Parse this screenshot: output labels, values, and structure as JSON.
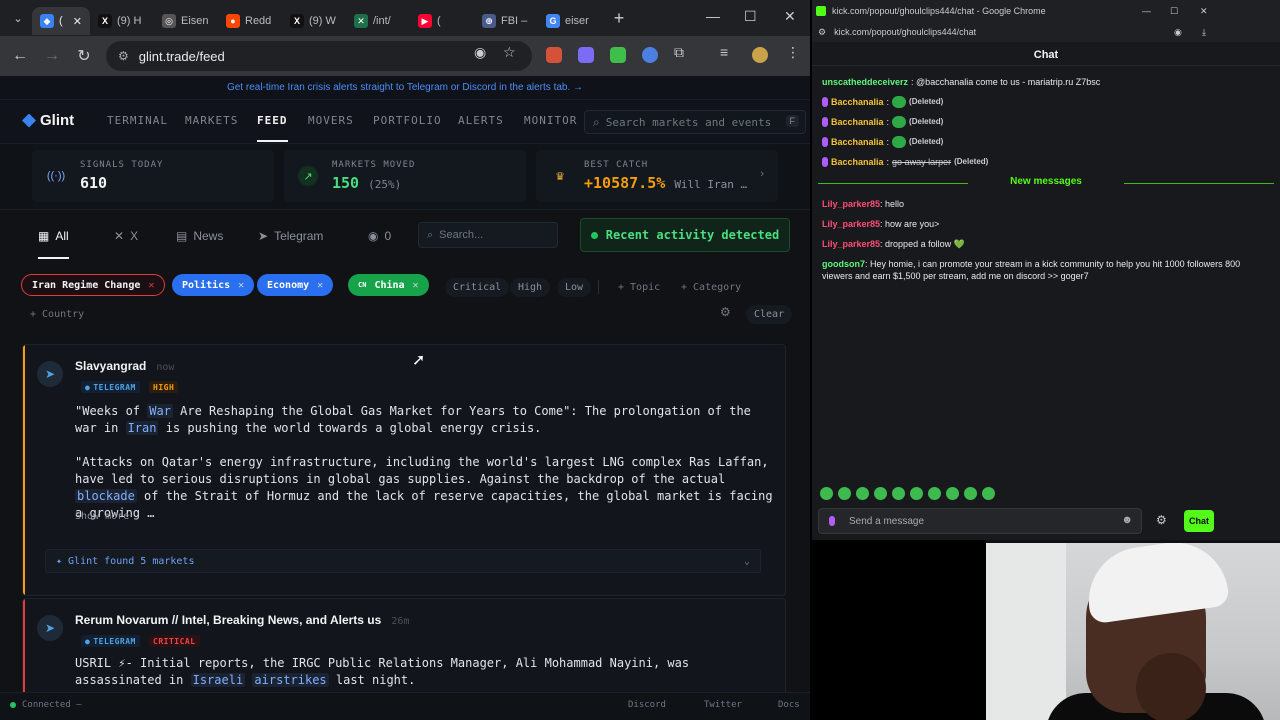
{
  "browser": {
    "tabs": [
      {
        "label": "(",
        "icon": "glint-icon",
        "color": "#3b82f6",
        "glyph": "◆",
        "active": true
      },
      {
        "label": "(9) H",
        "icon": "x-icon",
        "color": "#111111",
        "glyph": "X"
      },
      {
        "label": "Eisen",
        "icon": "web-icon",
        "color": "#555555",
        "glyph": "◎"
      },
      {
        "label": "Redd",
        "icon": "reddit-icon",
        "color": "#ff4500",
        "glyph": "●"
      },
      {
        "label": "(9) W",
        "icon": "x-icon",
        "color": "#111111",
        "glyph": "X"
      },
      {
        "label": "/int/",
        "icon": "board-icon",
        "color": "#1f6f4a",
        "glyph": "✕"
      },
      {
        "label": "(",
        "icon": "youtube-icon",
        "color": "#ff0033",
        "glyph": "▶"
      },
      {
        "label": "FBI –",
        "icon": "fbi-icon",
        "color": "#4a5a8a",
        "glyph": "⊕"
      },
      {
        "label": "eiser",
        "icon": "google-icon",
        "color": "#4285f4",
        "glyph": "G"
      }
    ],
    "url": "glint.trade/feed"
  },
  "site": {
    "banner": "Get real-time Iran crisis alerts straight to Telegram or Discord in the alerts tab. →",
    "logo": "Glint",
    "nav": [
      "TERMINAL",
      "MARKETS",
      "FEED",
      "MOVERS",
      "PORTFOLIO",
      "ALERTS",
      "MONITOR"
    ],
    "search_placeholder": "Search markets and events",
    "search_kbd": "F",
    "stats": {
      "signals_label": "SIGNALS TODAY",
      "signals_value": "610",
      "moved_label": "MARKETS MOVED",
      "moved_value": "150",
      "moved_sub": "(25%)",
      "catch_label": "BEST CATCH",
      "catch_value": "+10587.5%",
      "catch_sub": "Will Iran …"
    },
    "filters": {
      "all": "All",
      "x": "X",
      "news": "News",
      "telegram": "Telegram",
      "watch_count": "0",
      "search_placeholder": "Search...",
      "activity": "Recent activity detected"
    },
    "chips": {
      "iran": "Iran Regime Change",
      "politics": "Politics",
      "economy": "Economy",
      "china_flag": "CN",
      "china": "China",
      "critical": "Critical",
      "high": "High",
      "low": "Low",
      "topic": "+ Topic",
      "category": "+ Category",
      "country": "+ Country",
      "clear": "Clear"
    },
    "post1": {
      "source": "Slavyangrad",
      "time": "now",
      "channel": "TELEGRAM",
      "severity": "HIGH",
      "p1_a": "\"Weeks of ",
      "p1_hl1": "War",
      "p1_b": " Are Reshaping the Global Gas Market for Years to Come\": The prolongation of the war in ",
      "p1_hl2": "Iran",
      "p1_c": " is pushing the world towards a global energy crisis.",
      "p2_a": "\"Attacks on Qatar's energy infrastructure, including the world's largest LNG complex Ras Laffan, have led to serious disruptions in global gas supplies. Against the backdrop of the actual ",
      "p2_hl": "blockade",
      "p2_b": " of the Strait of Hormuz and the lack of reserve capacities, the global market is facing a growing …",
      "show_more": "Show more",
      "markets": "Glint found 5 markets"
    },
    "post2": {
      "source": "Rerum Novarum // Intel, Breaking News, and Alerts us",
      "time": "26m",
      "channel": "TELEGRAM",
      "severity": "CRITICAL",
      "a": "USRIL ⚡- Initial reports, the IRGC Public Relations Manager, Ali Mohammad Nayini, was assassinated in ",
      "hl1": "Israeli",
      "hl2": "airstrikes",
      "b": " last night."
    },
    "status": {
      "connected": "Connected",
      "dash": "–",
      "discord": "Discord",
      "twitter": "Twitter",
      "docs": "Docs"
    }
  },
  "chat": {
    "window_title": "kick.com/popout/ghoulclips444/chat - Google Chrome",
    "url": "kick.com/popout/ghoulclips444/chat",
    "header": "Chat",
    "messages": [
      {
        "user": "unscatheddeceiverz",
        "text": ": @bacchanalia come to us - mariatrip.ru Z7bsc"
      },
      {
        "user": "Bacchanalia",
        "deleted": "(Deleted)"
      },
      {
        "user": "Bacchanalia",
        "deleted": "(Deleted)"
      },
      {
        "user": "Bacchanalia",
        "deleted": "(Deleted)"
      },
      {
        "user": "Bacchanalia",
        "struck": "go away larper",
        "deleted": "(Deleted)"
      }
    ],
    "new_messages": "New messages",
    "new": [
      {
        "user": "Lily_parker85",
        "text": ": hello"
      },
      {
        "user": "Lily_parker85",
        "text": ": how are you>"
      },
      {
        "user": "Lily_parker85",
        "text": ": dropped a follow 💚"
      },
      {
        "user": "goodson7",
        "text": ": Hey homie, i can promote your stream in a kick community to help you hit 1000 followers 800 viewers and earn $1,500 per stream, add me on discord >> goger7"
      }
    ],
    "input_placeholder": "Send a message",
    "send": "Chat"
  }
}
